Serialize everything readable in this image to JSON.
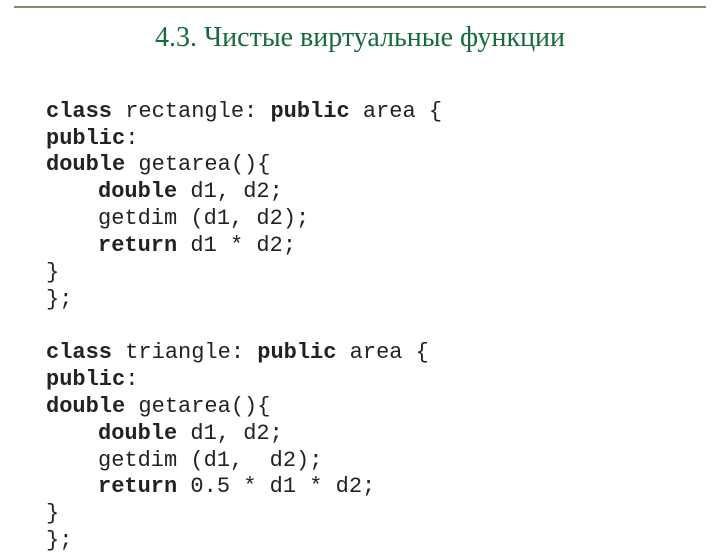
{
  "title": "4.3. Чистые виртуальные функции",
  "kw": {
    "class": "class",
    "public": "public",
    "double": "double",
    "return": "return"
  },
  "c1": {
    "decl_mid": " rectangle: ",
    "decl_end": " area {",
    "access": ":",
    "fn_sig": " getarea(){",
    "vars": " d1, d2;",
    "call": "getdim (d1, d2);",
    "ret_expr": " d1 * d2;",
    "brace1": "}",
    "brace2": "};"
  },
  "c2": {
    "decl_mid": " triangle: ",
    "decl_end": " area {",
    "access": ":",
    "fn_sig": " getarea(){",
    "vars": " d1, d2;",
    "call": "getdim (d1,  d2);",
    "ret_expr": " 0.5 * d1 * d2;",
    "brace1": "}",
    "brace2": "};"
  }
}
